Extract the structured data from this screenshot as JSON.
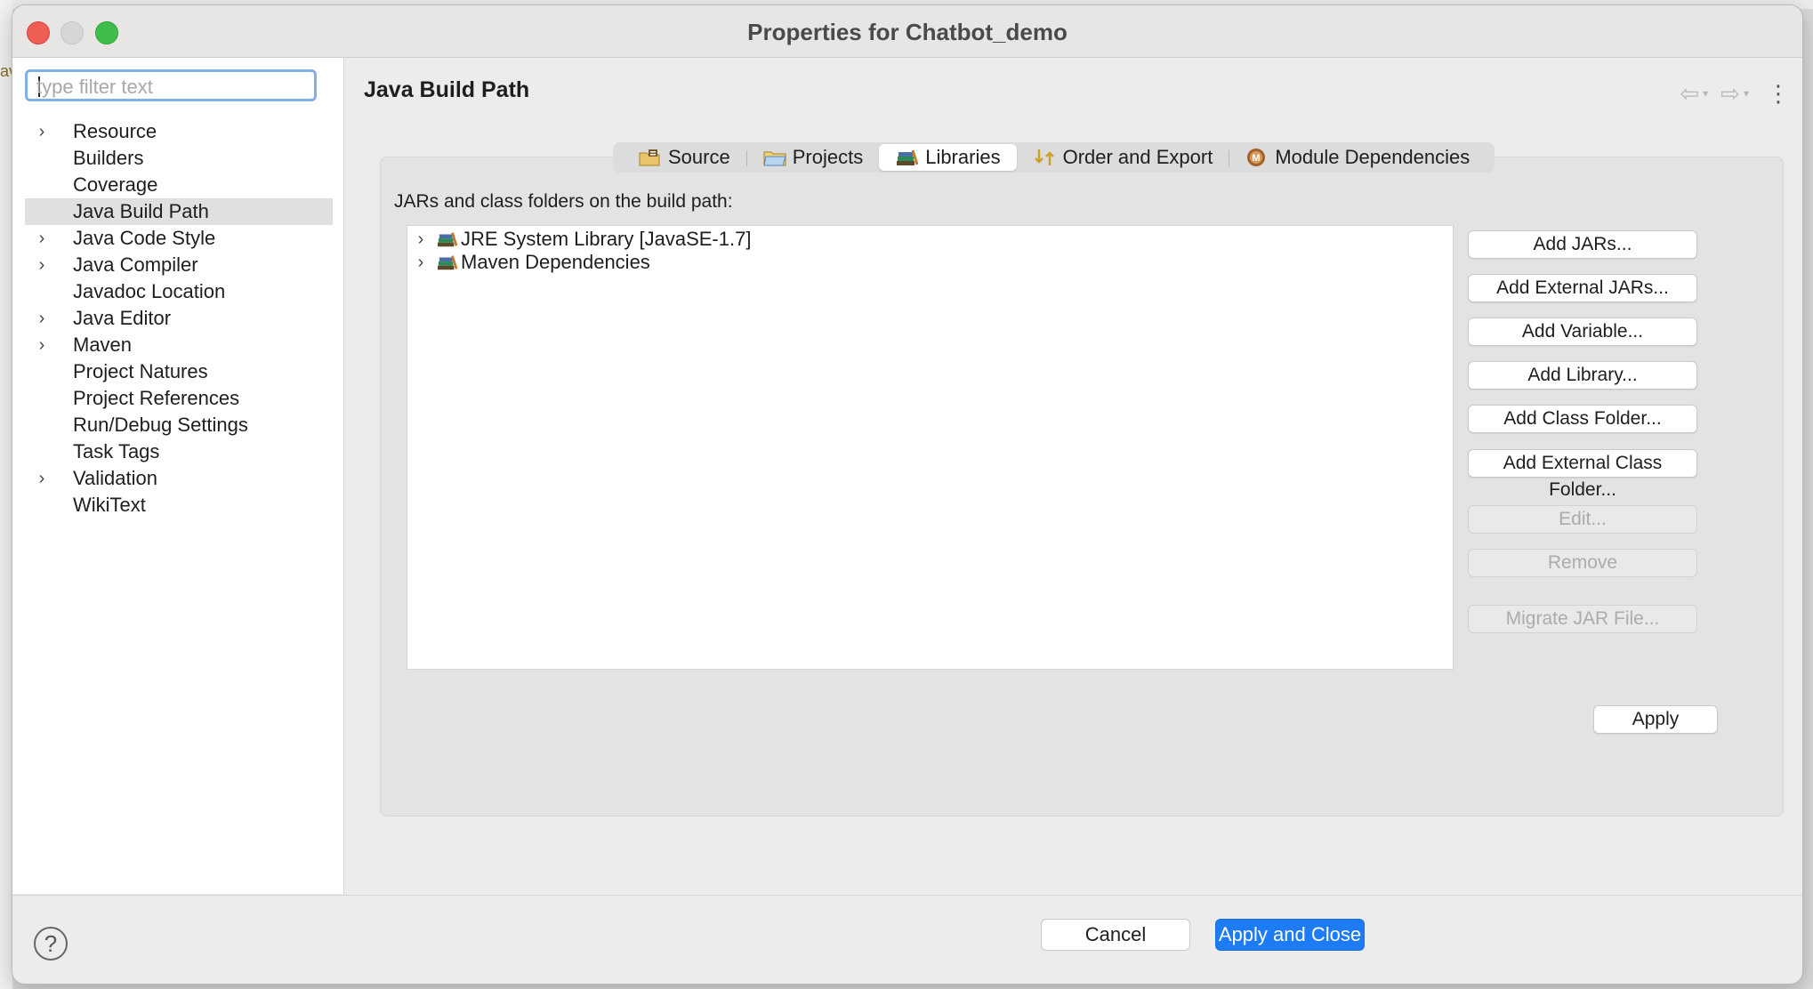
{
  "window": {
    "title": "Properties for Chatbot_demo"
  },
  "background": {
    "left_text": "av"
  },
  "sidebar": {
    "filter_placeholder": "type filter text",
    "items": [
      {
        "label": "Resource",
        "expandable": true
      },
      {
        "label": "Builders",
        "expandable": false
      },
      {
        "label": "Coverage",
        "expandable": false
      },
      {
        "label": "Java Build Path",
        "expandable": false,
        "selected": true
      },
      {
        "label": "Java Code Style",
        "expandable": true
      },
      {
        "label": "Java Compiler",
        "expandable": true
      },
      {
        "label": "Javadoc Location",
        "expandable": false
      },
      {
        "label": "Java Editor",
        "expandable": true
      },
      {
        "label": "Maven",
        "expandable": true
      },
      {
        "label": "Project Natures",
        "expandable": false
      },
      {
        "label": "Project References",
        "expandable": false
      },
      {
        "label": "Run/Debug Settings",
        "expandable": false
      },
      {
        "label": "Task Tags",
        "expandable": false
      },
      {
        "label": "Validation",
        "expandable": true
      },
      {
        "label": "WikiText",
        "expandable": false
      }
    ]
  },
  "page": {
    "title": "Java Build Path",
    "tabs": [
      {
        "label": "Source",
        "icon": "source-folder-icon"
      },
      {
        "label": "Projects",
        "icon": "projects-folder-icon"
      },
      {
        "label": "Libraries",
        "icon": "libraries-icon",
        "active": true
      },
      {
        "label": "Order and Export",
        "icon": "order-export-icon"
      },
      {
        "label": "Module Dependencies",
        "icon": "module-dependencies-icon"
      }
    ],
    "build_path_label": "JARs and class folders on the build path:",
    "libraries": [
      {
        "label": "JRE System Library [JavaSE-1.7]"
      },
      {
        "label": "Maven Dependencies"
      }
    ],
    "buttons": {
      "add_jars": "Add JARs...",
      "add_external_jars": "Add External JARs...",
      "add_variable": "Add Variable...",
      "add_library": "Add Library...",
      "add_class_folder": "Add Class Folder...",
      "add_external_class_folder": "Add External Class Folder...",
      "edit": "Edit...",
      "remove": "Remove",
      "migrate_jar": "Migrate JAR File..."
    },
    "apply": "Apply"
  },
  "footer": {
    "help_icon": "?",
    "cancel": "Cancel",
    "apply_and_close": "Apply and Close"
  },
  "colors": {
    "primary_button": "#1d7bf5",
    "close": "#ee5e55",
    "zoom": "#3ebd4a",
    "focus_ring": "#7fb0ea"
  }
}
